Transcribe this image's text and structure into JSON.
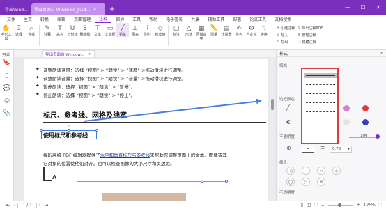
{
  "window": {
    "doc_tabs": [
      {
        "label": "导出Wind..."
      },
      {
        "label": "导出页面自 Windows_guid..."
      },
      {
        "label": "+"
      }
    ],
    "controls": [
      "minimize",
      "maximize",
      "close"
    ]
  },
  "menu": {
    "items": [
      "文件",
      "主页",
      "转换",
      "编辑",
      "页面管理",
      "注释",
      "保护",
      "工具",
      "帮助",
      "电子签名",
      "共享",
      "辅助工具",
      "部署",
      "论文工具",
      "文档搜索"
    ],
    "active": "注释"
  },
  "ribbon": {
    "buttons": [
      {
        "label": "手形工具",
        "icon": "hand-icon"
      },
      {
        "label": "选择",
        "icon": "select-icon"
      },
      {
        "label": "查找",
        "icon": "find-icon"
      },
      {
        "label": "注释",
        "icon": "note-icon"
      },
      {
        "label": "高亮",
        "icon": "highlight-icon"
      },
      {
        "label": "下划线",
        "icon": "underline-icon"
      },
      {
        "label": "删除线",
        "icon": "strike-icon"
      },
      {
        "label": "文本",
        "icon": "text-icon"
      },
      {
        "label": "文本框",
        "icon": "textbox-icon"
      },
      {
        "label": "铅笔",
        "icon": "pencil-icon"
      },
      {
        "label": "图章",
        "icon": "stamp-icon"
      },
      {
        "label": "附件",
        "icon": "attach-icon"
      },
      {
        "label": "橡皮擦",
        "icon": "eraser-icon"
      },
      {
        "label": "标注",
        "icon": "callout-icon"
      },
      {
        "label": "形状",
        "icon": "shape-icon"
      },
      {
        "label": "区域高亮",
        "icon": "area-icon"
      },
      {
        "label": "测量",
        "icon": "measure-icon"
      },
      {
        "label": "计算器",
        "icon": "calc-icon"
      },
      {
        "label": "签名",
        "icon": "sign-icon"
      },
      {
        "label": "自定义",
        "icon": "custom-icon"
      },
      {
        "label": "排序",
        "icon": "sort-icon"
      }
    ],
    "mini": [
      {
        "label": "小结注释",
        "icon": "+"
      },
      {
        "label": "导出注释PDF",
        "icon": "⇧"
      },
      {
        "label": "导入",
        "icon": "⇩"
      },
      {
        "label": "管理注释",
        "icon": "≡"
      },
      {
        "label": "导出",
        "icon": "⇧"
      },
      {
        "label": "隐藏注释",
        "icon": "◌"
      }
    ]
  },
  "left_panel": {
    "title": "开始"
  },
  "doc_strip": {
    "tab": "导出页面自 Window...",
    "close": "×"
  },
  "page": {
    "bullets": [
      "调整朗读速度：选择 “视图” > “朗读” > “速度” >拖动滑块进行调整。",
      "调整朗读音量：选择 “视图” > “朗读” > “音量” >拖动滑块进行调整。",
      "暂停朗读：选择 “视图” > “朗读” > “暂停”。",
      "停止朗读：选择 “视图” > “朗读” > “停止”。"
    ],
    "heading1": "标尺、参考线、网格及线宽",
    "heading2": "使用标尺和参考线",
    "para1_a": "福昕高级 PDF 编辑器提供了",
    "para1_link": "水平和垂直标尺与参考线",
    "para1_b": "来帮助您调整页面上的文本、图像或其",
    "para2": "它对象的位置使他们对齐。也可以检查图像的大小尺寸和页边距。",
    "corner_letter": "A"
  },
  "right_panel": {
    "title": "样式",
    "close": "×",
    "section_fill": "填充",
    "section_border": "边框颜色",
    "section_opacity": "不透明度",
    "opacity_value": "100",
    "section_line": "线头",
    "section_other": "不透明度",
    "line_width": "0.75",
    "colors": [
      "#d080d6",
      "#e23a3a",
      "#e3e3e3",
      "#3a3ad2"
    ],
    "dash_styles": [
      "solid",
      "dash-1",
      "dash-2",
      "dash-3",
      "dash-4",
      "dash-5",
      "dash-6",
      "dash-7"
    ]
  },
  "status": {
    "page_current": "1",
    "page_total": "1 / 1",
    "zoom": "125%"
  }
}
